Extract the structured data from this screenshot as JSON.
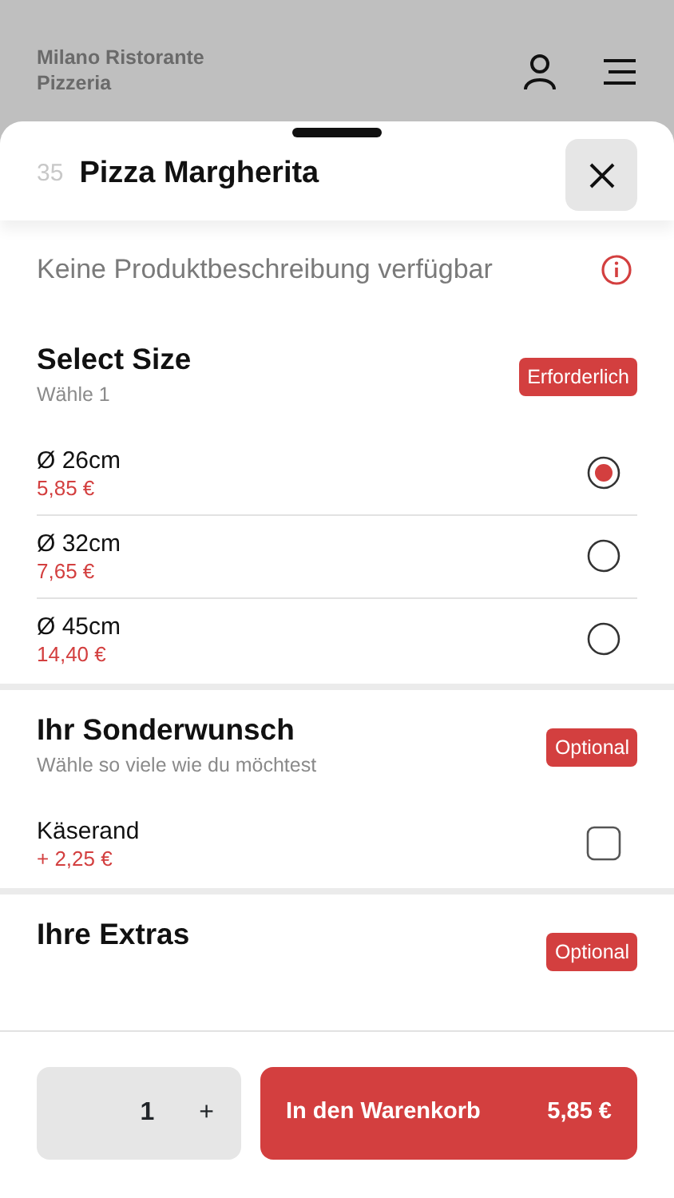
{
  "restaurant": {
    "name_lines": [
      "Milano Ristorante",
      "Pizzeria"
    ]
  },
  "product": {
    "number": "35",
    "title": "Pizza Margherita",
    "description": "Keine Produktbeschreibung verfügbar"
  },
  "sections": [
    {
      "title": "Select Size",
      "hint": "Wähle 1",
      "badge": "Erforderlich",
      "kind": "radio",
      "options": [
        {
          "label": "Ø 26cm",
          "price": "5,85 €",
          "selected": true
        },
        {
          "label": "Ø 32cm",
          "price": "7,65 €",
          "selected": false
        },
        {
          "label": "Ø 45cm",
          "price": "14,40 €",
          "selected": false
        }
      ]
    },
    {
      "title": "Ihr Sonderwunsch",
      "hint": "Wähle so viele wie du möchtest",
      "badge": "Optional",
      "kind": "checkbox",
      "options": [
        {
          "label": "Käserand",
          "price": "+ 2,25 €",
          "checked": false
        }
      ]
    },
    {
      "title": "Ihre Extras",
      "badge": "Optional"
    }
  ],
  "footer": {
    "quantity": "1",
    "plus": "+",
    "cart_label": "In den Warenkorb",
    "cart_total": "5,85 €"
  }
}
